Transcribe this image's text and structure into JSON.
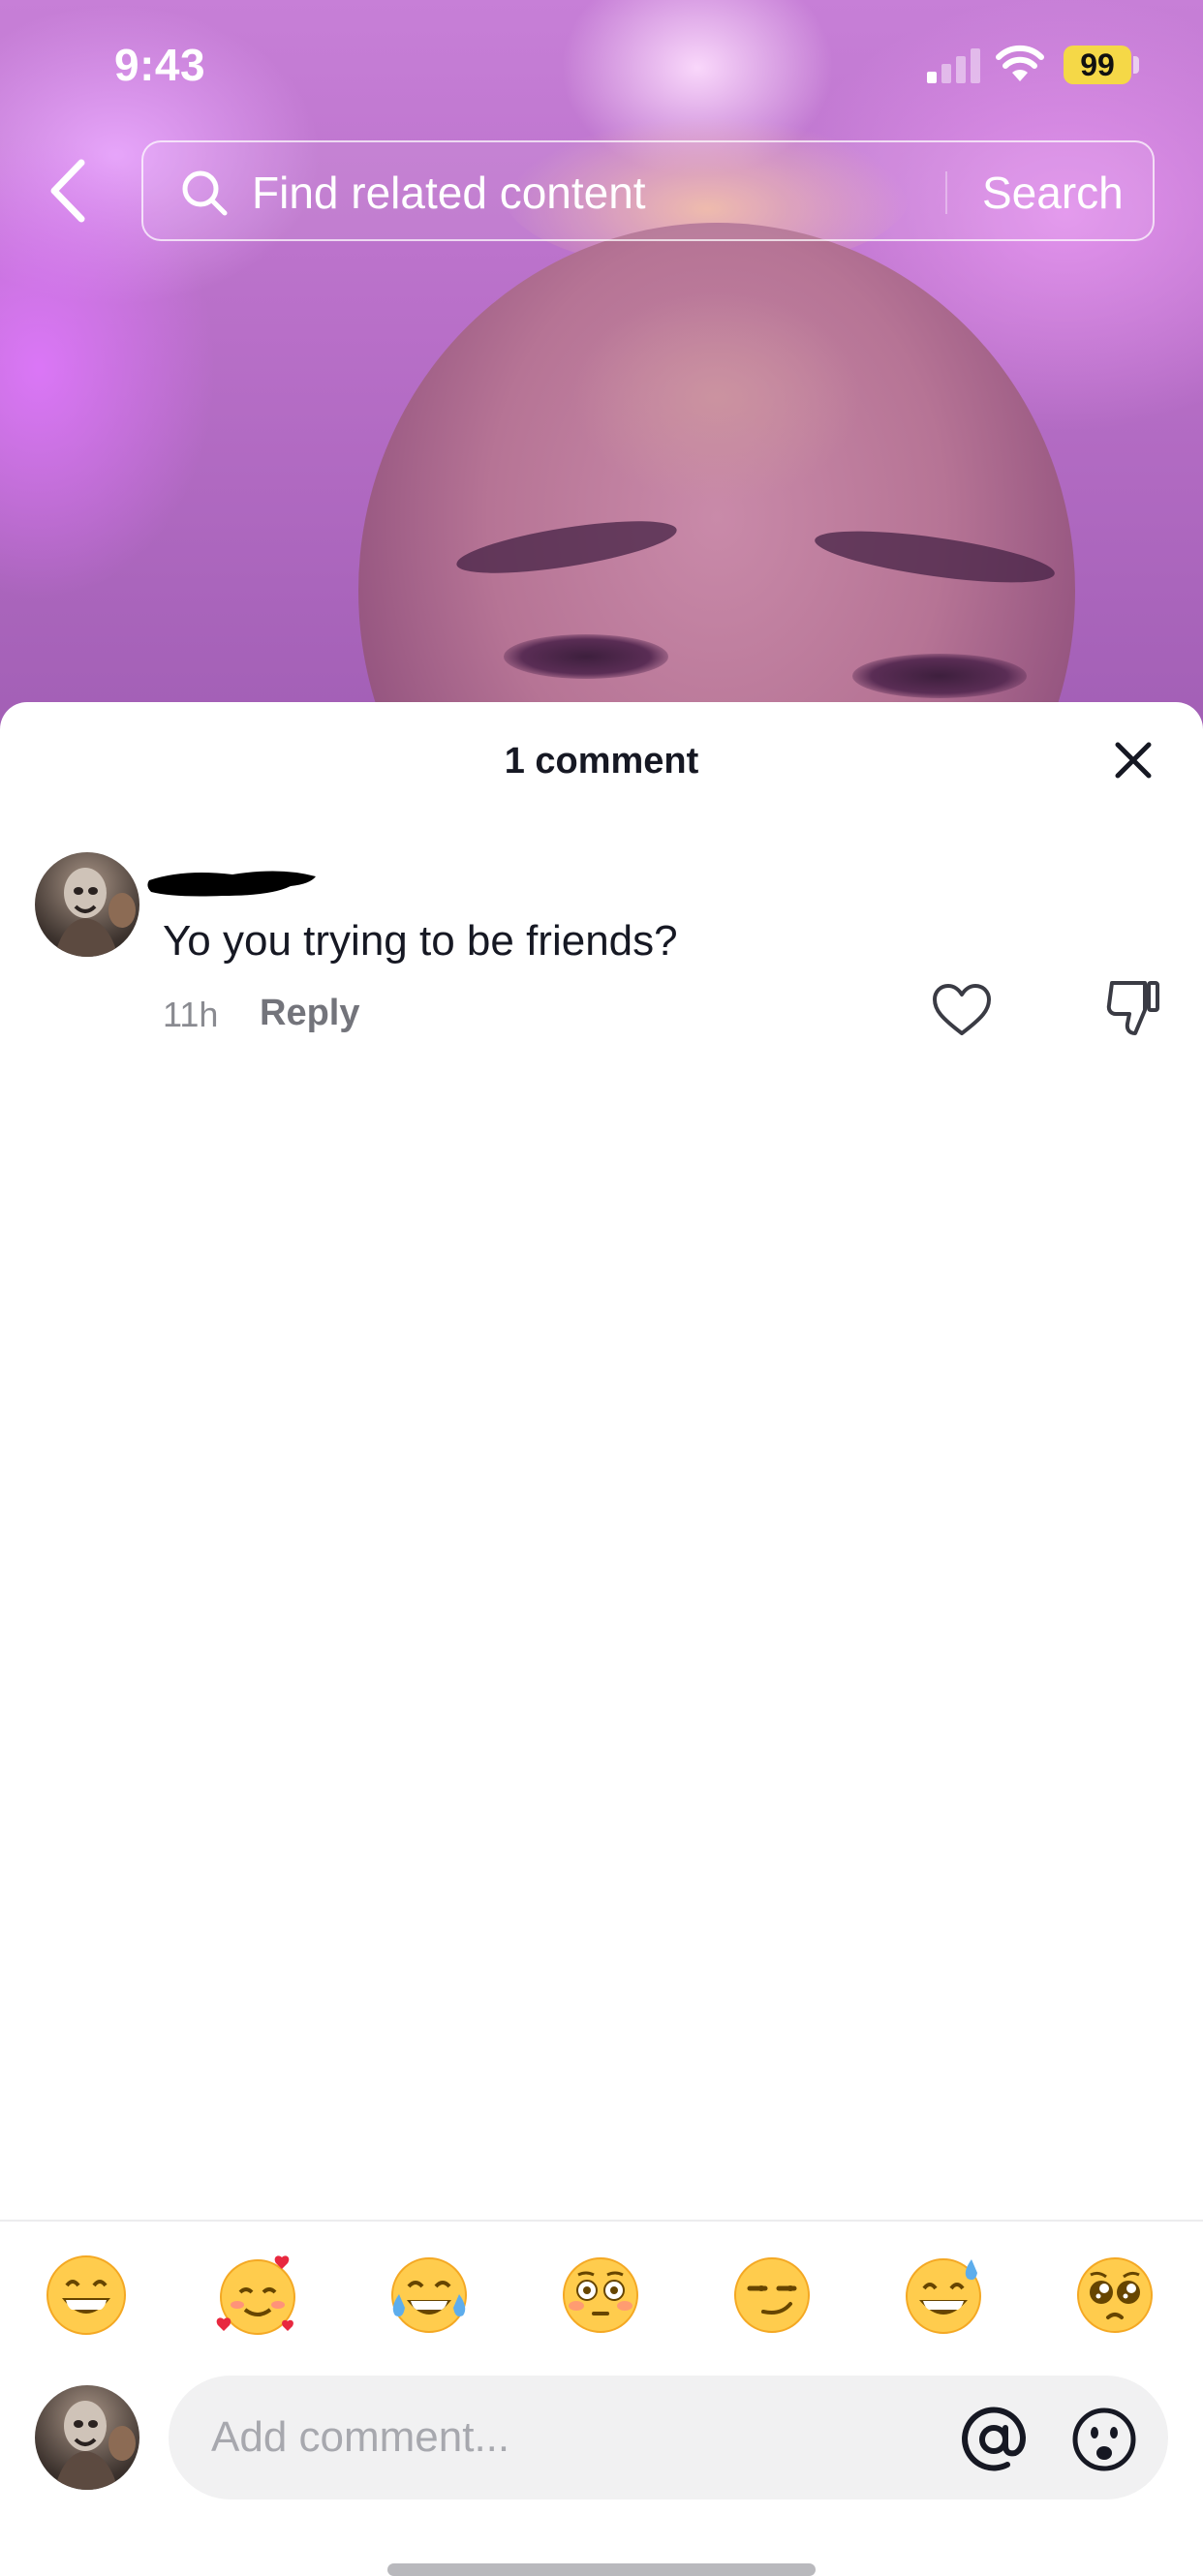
{
  "status_bar": {
    "time": "9:43",
    "battery_level": "99",
    "battery_color": "#f5d847"
  },
  "search": {
    "placeholder": "Find related content",
    "button_label": "Search",
    "back_icon": "chevron-left-icon",
    "search_icon": "magnifier-icon"
  },
  "comments_sheet": {
    "title": "1 comment",
    "close_icon": "close-icon",
    "comments": [
      {
        "avatar": "user-avatar",
        "username_redacted": true,
        "text": "Yo you trying to be friends?",
        "time": "11h",
        "reply_label": "Reply",
        "like_icon": "heart-outline-icon",
        "dislike_icon": "thumbs-down-icon"
      }
    ]
  },
  "composer": {
    "quick_emojis": [
      {
        "name": "grinning-face",
        "char": "😁"
      },
      {
        "name": "smiling-face-with-hearts",
        "char": "🥰"
      },
      {
        "name": "tears-of-joy",
        "char": "😂"
      },
      {
        "name": "flushed-face",
        "char": "😳"
      },
      {
        "name": "smirking-face",
        "char": "😏"
      },
      {
        "name": "grinning-face-with-sweat",
        "char": "😅"
      },
      {
        "name": "pleading-face",
        "char": "🥺"
      }
    ],
    "input_placeholder": "Add comment...",
    "mention_icon": "at-sign-icon",
    "emoji_icon": "emoji-picker-icon"
  },
  "colors": {
    "text_primary": "#161823",
    "text_secondary": "#8a8b91",
    "input_background": "#f1f1f2",
    "video_tint": "#b86fc8"
  }
}
